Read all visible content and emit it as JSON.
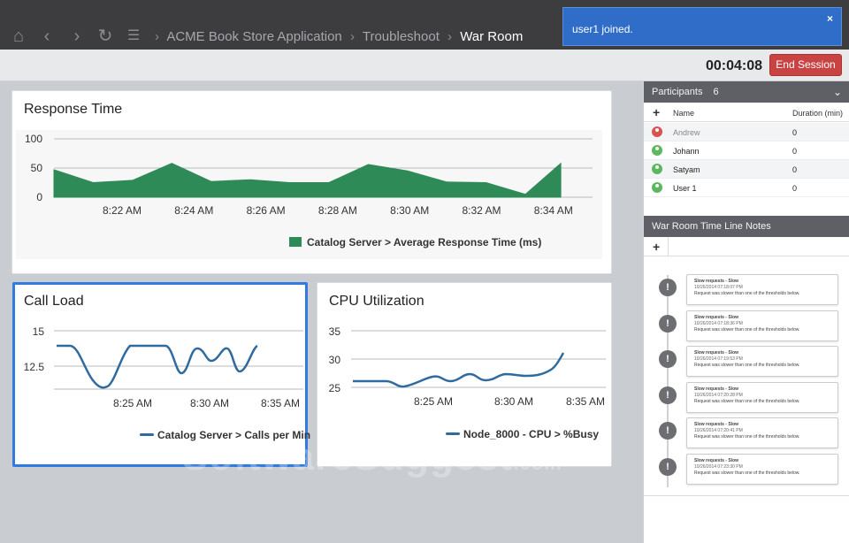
{
  "breadcrumb": {
    "items": [
      "ACME Book Store Application",
      "Troubleshoot",
      "War Room"
    ]
  },
  "toast": {
    "message": "user1 joined.",
    "close": "×"
  },
  "session": {
    "timer": "00:04:08",
    "end_label": "End Session"
  },
  "response_time": {
    "title": "Response Time",
    "legend": "Catalog Server > Average Response Time (ms)"
  },
  "call_load": {
    "title": "Call Load",
    "legend": "Catalog Server > Calls per Min"
  },
  "cpu": {
    "title": "CPU Utilization",
    "legend": "Node_8000 - CPU > %Busy"
  },
  "chart_data": [
    {
      "type": "area",
      "title": "Response Time",
      "y_ticks": [
        "100",
        "50",
        "0"
      ],
      "ylim": [
        0,
        100
      ],
      "x_ticks": [
        "8:22 AM",
        "8:24 AM",
        "8:26 AM",
        "8:28 AM",
        "8:30 AM",
        "8:32 AM",
        "8:34 AM"
      ],
      "series": [
        {
          "name": "Catalog Server > Average Response Time (ms)",
          "color": "#2e8a57",
          "x": [
            "8:21",
            "8:22",
            "8:23",
            "8:24",
            "8:25",
            "8:26",
            "8:27",
            "8:28",
            "8:29",
            "8:30",
            "8:31",
            "8:32",
            "8:33"
          ],
          "values": [
            47,
            25,
            29,
            58,
            27,
            30,
            25,
            25,
            56,
            45,
            26,
            25,
            5
          ]
        }
      ]
    },
    {
      "type": "line",
      "title": "Call Load",
      "y_ticks": [
        "15",
        "12.5"
      ],
      "x_ticks": [
        "8:25 AM",
        "8:30 AM",
        "8:35 AM"
      ],
      "series": [
        {
          "name": "Catalog Server > Calls per Min",
          "color": "#2f6b9e"
        }
      ]
    },
    {
      "type": "line",
      "title": "CPU Utilization",
      "y_ticks": [
        "35",
        "30",
        "25"
      ],
      "x_ticks": [
        "8:25 AM",
        "8:30 AM",
        "8:35 AM"
      ],
      "series": [
        {
          "name": "Node_8000 - CPU > %Busy",
          "color": "#2f6b9e"
        }
      ]
    }
  ],
  "participants": {
    "title": "Participants",
    "count": "6",
    "columns": {
      "add": "+",
      "name": "Name",
      "duration": "Duration (min)"
    },
    "rows": [
      {
        "name": "Andrew",
        "duration": "0",
        "status_color": "#d9534f"
      },
      {
        "name": "Johann",
        "duration": "0",
        "status_color": "#5cb85c"
      },
      {
        "name": "Satyam",
        "duration": "0",
        "status_color": "#5cb85c"
      },
      {
        "name": "User 1",
        "duration": "0",
        "status_color": "#5cb85c"
      }
    ]
  },
  "timeline": {
    "title": "War Room Time Line Notes",
    "add": "+",
    "notes": [
      {
        "title": "Slow requests - Slow",
        "date": "10/26/2014 07:18:07 PM",
        "text": "Request was slower than one of the thresholds below."
      },
      {
        "title": "Slow requests - Slow",
        "date": "10/26/2014 07:18:36 PM",
        "text": "Request was slower than one of the thresholds below."
      },
      {
        "title": "Slow requests - Slow",
        "date": "10/26/2014 07:19:53 PM",
        "text": "Request was slower than one of the thresholds below."
      },
      {
        "title": "Slow requests - Slow",
        "date": "10/26/2014 07:20:28 PM",
        "text": "Request was slower than one of the thresholds below."
      },
      {
        "title": "Slow requests - Slow",
        "date": "10/26/2014 07:20:41 PM",
        "text": "Request was slower than one of the thresholds below."
      },
      {
        "title": "Slow requests - Slow",
        "date": "10/26/2014 07:23:30 PM",
        "text": "Request was slower than one of the thresholds below."
      }
    ]
  },
  "watermark": {
    "main": "SoftwareSuggest",
    "suffix": ".com"
  },
  "icons": {
    "home": "home-icon",
    "back": "back-arrow-icon",
    "forward": "forward-arrow-icon",
    "refresh": "refresh-icon",
    "menu": "menu-icon",
    "warning": "warning-icon"
  }
}
